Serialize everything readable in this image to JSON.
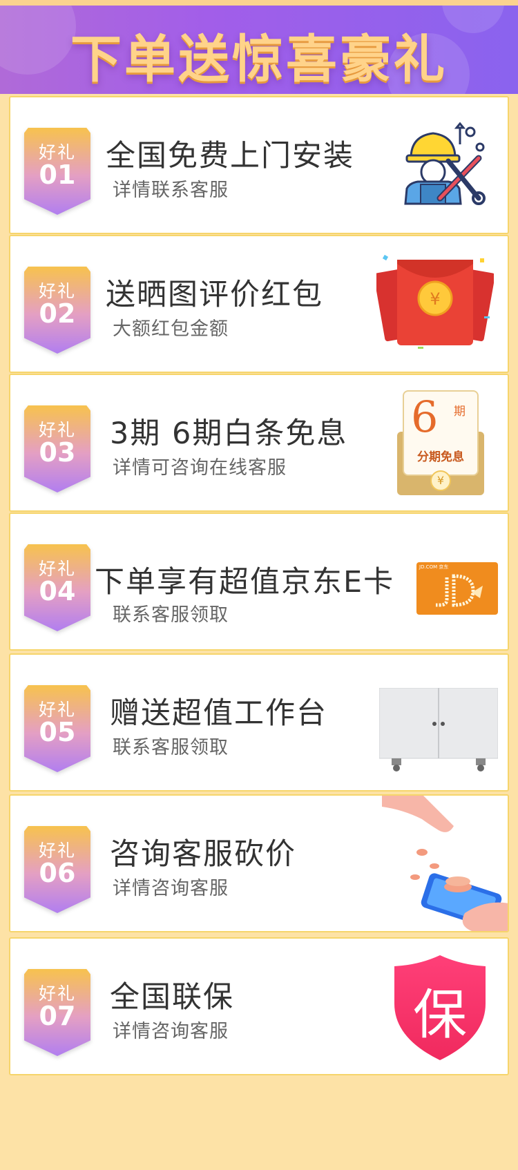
{
  "banner": {
    "title": "下单送惊喜豪礼"
  },
  "badge_label": "好礼",
  "items": [
    {
      "num": "01",
      "title": "全国免费上门安装",
      "sub": "详情联系客服",
      "icon": "installer-icon"
    },
    {
      "num": "02",
      "title": "送晒图评价红包",
      "sub": "大额红包金额",
      "icon": "red-envelope-icon"
    },
    {
      "num": "03",
      "title": "3期 6期白条免息",
      "sub": "详情可咨询在线客服",
      "icon": "installment-icon",
      "icon_text": {
        "number": "6",
        "unit": "期",
        "caption": "分期免息",
        "currency": "¥"
      }
    },
    {
      "num": "04",
      "title": "下单享有超值京东E卡",
      "sub": "联系客服领取",
      "icon": "jd-card-icon",
      "icon_text": {
        "brand": "JD.COM 京东"
      }
    },
    {
      "num": "05",
      "title": "赠送超值工作台",
      "sub": "联系客服领取",
      "icon": "workbench-icon"
    },
    {
      "num": "06",
      "title": "咨询客服砍价",
      "sub": "详情咨询客服",
      "icon": "hand-coins-icon"
    },
    {
      "num": "07",
      "title": "全国联保",
      "sub": "详情咨询客服",
      "icon": "warranty-shield-icon",
      "icon_text": {
        "char": "保"
      }
    }
  ]
}
